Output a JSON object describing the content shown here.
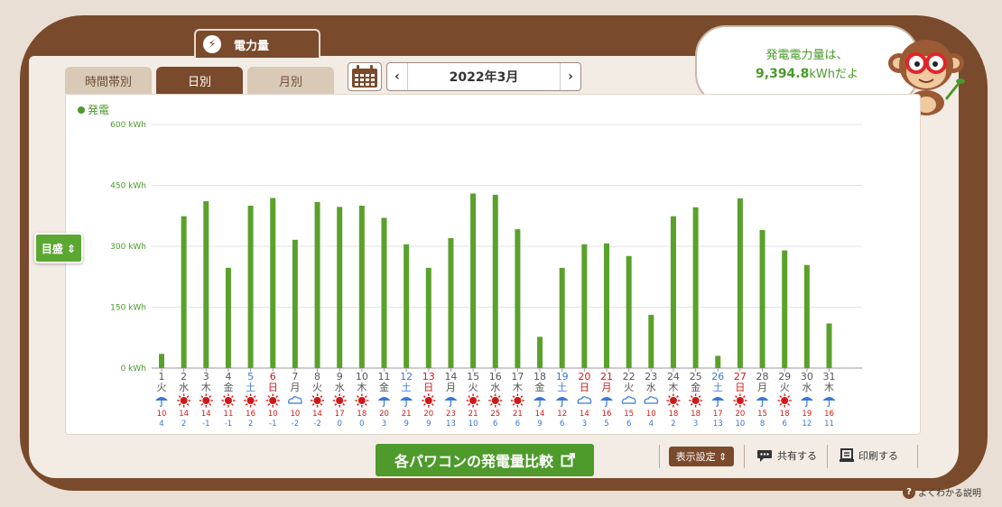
{
  "tabs": {
    "electricity": "電力量"
  },
  "period_tabs": [
    "時間帯別",
    "日別",
    "月別"
  ],
  "active_period": "日別",
  "date_nav": {
    "label": "2022年3月",
    "prev": "‹",
    "next": "›"
  },
  "bubble": {
    "line1": "発電電力量は、",
    "value": "9,394.8",
    "unit": "kWhだよ"
  },
  "legend": {
    "label": "発電"
  },
  "scale_button": {
    "label": "目盛 ⇕"
  },
  "compare_button": {
    "label": "各パワコンの発電量比較"
  },
  "toolbar": {
    "display_settings": "表示設定 ⇕",
    "share": "共有する",
    "print": "印刷する"
  },
  "help": {
    "label": "よくわかる説明"
  },
  "colors": {
    "brown": "#7a4a2c",
    "green": "#5aa12b",
    "legend_green": "#4a9a2a",
    "sat_blue": "#3a78d8",
    "sun_red": "#d01818"
  },
  "chart_data": {
    "type": "bar",
    "series": [
      {
        "name": "発電",
        "values": [
          35,
          374,
          411,
          247,
          400,
          419,
          316,
          409,
          397,
          400,
          370,
          305,
          247,
          320,
          430,
          427,
          342,
          77,
          247,
          305,
          307,
          276,
          131,
          374,
          396,
          30,
          418,
          340,
          290,
          254,
          110
        ]
      }
    ],
    "ylim": [
      0,
      600
    ],
    "yticks": [
      "0 kWh",
      "150 kWh",
      "300 kWh",
      "450 kWh",
      "600 kWh"
    ],
    "grid": true,
    "days": [
      "1",
      "2",
      "3",
      "4",
      "5",
      "6",
      "7",
      "8",
      "9",
      "10",
      "11",
      "12",
      "13",
      "14",
      "15",
      "16",
      "17",
      "18",
      "19",
      "20",
      "21",
      "22",
      "23",
      "24",
      "25",
      "26",
      "27",
      "28",
      "29",
      "30",
      "31"
    ],
    "weekdays": [
      "火",
      "水",
      "木",
      "金",
      "土",
      "日",
      "月",
      "火",
      "水",
      "木",
      "金",
      "土",
      "日",
      "月",
      "火",
      "水",
      "木",
      "金",
      "土",
      "日",
      "月",
      "火",
      "水",
      "木",
      "金",
      "土",
      "日",
      "月",
      "火",
      "水",
      "木"
    ],
    "day_colors": [
      "n",
      "n",
      "n",
      "n",
      "sat",
      "sun",
      "n",
      "n",
      "n",
      "n",
      "n",
      "sat",
      "sun",
      "n",
      "n",
      "n",
      "n",
      "n",
      "sat",
      "sun",
      "sun",
      "n",
      "n",
      "n",
      "n",
      "sat",
      "sun",
      "n",
      "n",
      "n",
      "n"
    ],
    "weather": [
      "umbrella",
      "sun",
      "sun",
      "sun",
      "sun",
      "sun",
      "cloud",
      "sun",
      "sun",
      "sun",
      "umbrella",
      "umbrella",
      "sun",
      "umbrella",
      "sun",
      "sun",
      "sun",
      "umbrella",
      "umbrella",
      "cloud",
      "umbrella",
      "cloud",
      "cloud",
      "sun",
      "sun",
      "umbrella",
      "sun",
      "umbrella",
      "sun",
      "umbrella",
      "umbrella"
    ],
    "temp_high": [
      "10",
      "14",
      "14",
      "11",
      "16",
      "10",
      "10",
      "14",
      "17",
      "18",
      "20",
      "21",
      "20",
      "23",
      "21",
      "25",
      "21",
      "14",
      "12",
      "14",
      "16",
      "15",
      "10",
      "18",
      "18",
      "17",
      "20",
      "15",
      "18",
      "19",
      "16"
    ],
    "temp_low": [
      "4",
      "2",
      "-1",
      "-1",
      "2",
      "-1",
      "-2",
      "-2",
      "0",
      "0",
      "3",
      "9",
      "9",
      "13",
      "10",
      "6",
      "6",
      "9",
      "6",
      "3",
      "5",
      "6",
      "4",
      "2",
      "3",
      "13",
      "10",
      "8",
      "6",
      "12",
      "11"
    ]
  }
}
